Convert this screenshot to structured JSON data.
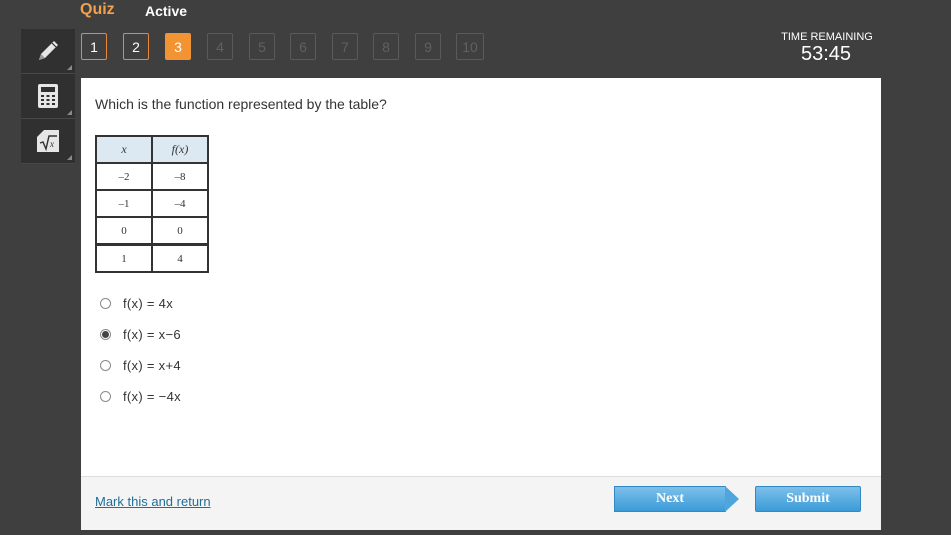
{
  "header": {
    "title": "Quiz",
    "status": "Active"
  },
  "navigator": {
    "questions": [
      "1",
      "2",
      "3",
      "4",
      "5",
      "6",
      "7",
      "8",
      "9",
      "10"
    ],
    "current": "3",
    "answered": [
      "1",
      "2"
    ]
  },
  "timer": {
    "label": "TIME REMAINING",
    "value": "53:45"
  },
  "tools": [
    "pencil-icon",
    "calculator-icon",
    "formula-sheet-icon"
  ],
  "question": {
    "text": "Which is the function represented by the table?",
    "table": {
      "headers": [
        "x",
        "f(x)"
      ],
      "rows": [
        [
          "–2",
          "–8"
        ],
        [
          "–1",
          "–4"
        ],
        [
          "0",
          "0"
        ],
        [
          "1",
          "4"
        ]
      ]
    },
    "choices": [
      {
        "label": "f(x) = 4x",
        "selected": false
      },
      {
        "label": "f(x) = x−6",
        "selected": true
      },
      {
        "label": "f(x) = x+4",
        "selected": false
      },
      {
        "label": "f(x) = −4x",
        "selected": false
      }
    ]
  },
  "footer": {
    "mark_link": "Mark this and return",
    "next_label": "Next",
    "submit_label": "Submit"
  },
  "colors": {
    "background": "#3f3f3f",
    "accent_orange": "#f39434",
    "button_blue": "#3b9bd8",
    "link_blue": "#1f6f98",
    "table_header": "#dde9f2"
  }
}
